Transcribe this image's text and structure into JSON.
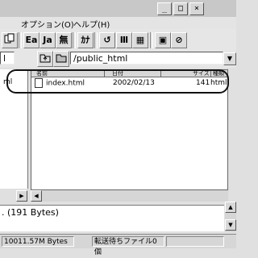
{
  "window": {
    "minimize_glyph": "_",
    "maximize_glyph": "□",
    "close_glyph": "×"
  },
  "menu": {
    "items": [
      "オプション(O)",
      "ヘルプ(H)"
    ]
  },
  "toolbar": {
    "buttons": [
      "Ea",
      "Ja",
      "無",
      "ｶﾅ",
      "↺",
      "Ⅲ",
      "▦",
      "▣",
      "⊘"
    ]
  },
  "path": {
    "local_value": "l",
    "remote_value": "/public_html"
  },
  "left_pane": {
    "item": "ml"
  },
  "file_list": {
    "columns": [
      "名前",
      "日付",
      "サイズ",
      "種類"
    ],
    "rows": [
      {
        "name": "index.html",
        "date": "2002/02/13",
        "size": "141",
        "type": "html"
      }
    ]
  },
  "log": {
    "line": ". (191 Bytes)"
  },
  "status": {
    "disk": "10011.57M Bytes",
    "queue": "転送待ちファイル0個"
  }
}
